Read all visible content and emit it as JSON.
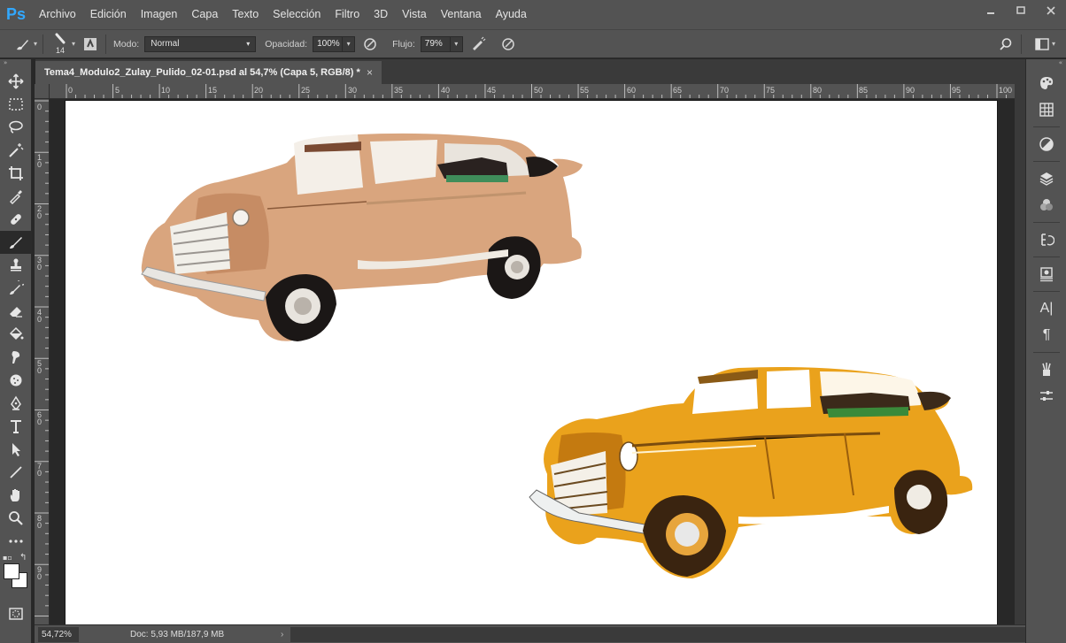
{
  "app": {
    "logo": "Ps"
  },
  "menu": {
    "items": [
      "Archivo",
      "Edición",
      "Imagen",
      "Capa",
      "Texto",
      "Selección",
      "Filtro",
      "3D",
      "Vista",
      "Ventana",
      "Ayuda"
    ]
  },
  "window_controls": [
    "minimize-icon",
    "restore-icon",
    "close-icon"
  ],
  "options": {
    "brush_size": "14",
    "mode_label": "Modo:",
    "mode_value": "Normal",
    "opacity_label": "Opacidad:",
    "opacity_value": "100%",
    "flow_label": "Flujo:",
    "flow_value": "79%"
  },
  "document": {
    "tab_title": "Tema4_Modulo2_Zulay_Pulido_02-01.psd al 54,7% (Capa 5, RGB/8) *",
    "tab_close": "×"
  },
  "ruler": {
    "horizontal": [
      "0",
      "5",
      "10",
      "15",
      "20",
      "25",
      "30",
      "35",
      "40",
      "45",
      "50",
      "55",
      "60",
      "65",
      "70",
      "75",
      "80",
      "85",
      "90",
      "95",
      "100"
    ],
    "vertical": [
      "0",
      "1 0",
      "2 0",
      "3 0",
      "4 0",
      "5 0",
      "6 0",
      "7 0",
      "8 0",
      "9 0"
    ]
  },
  "tools": [
    "move-icon",
    "marquee-icon",
    "lasso-icon",
    "magic-wand-icon",
    "crop-icon",
    "eyedropper-icon",
    "healing-icon",
    "brush-icon",
    "stamp-icon",
    "history-brush-icon",
    "eraser-icon",
    "bucket-icon",
    "smudge-icon",
    "sponge-icon",
    "pen-icon",
    "type-icon",
    "path-select-icon",
    "line-icon",
    "hand-icon",
    "zoom-icon",
    "more-icon"
  ],
  "status": {
    "zoom": "54,72%",
    "doc_info": "Doc: 5,93 MB/187,9 MB",
    "arrow": "›"
  },
  "dock": {
    "char_label": "A|",
    "para_label": "¶"
  },
  "colors": {
    "ui_bg": "#535353",
    "workspace": "#282828",
    "canvas": "#ffffff",
    "car_sepia": "#d9a57e",
    "car_yellow": "#eaa21c"
  }
}
